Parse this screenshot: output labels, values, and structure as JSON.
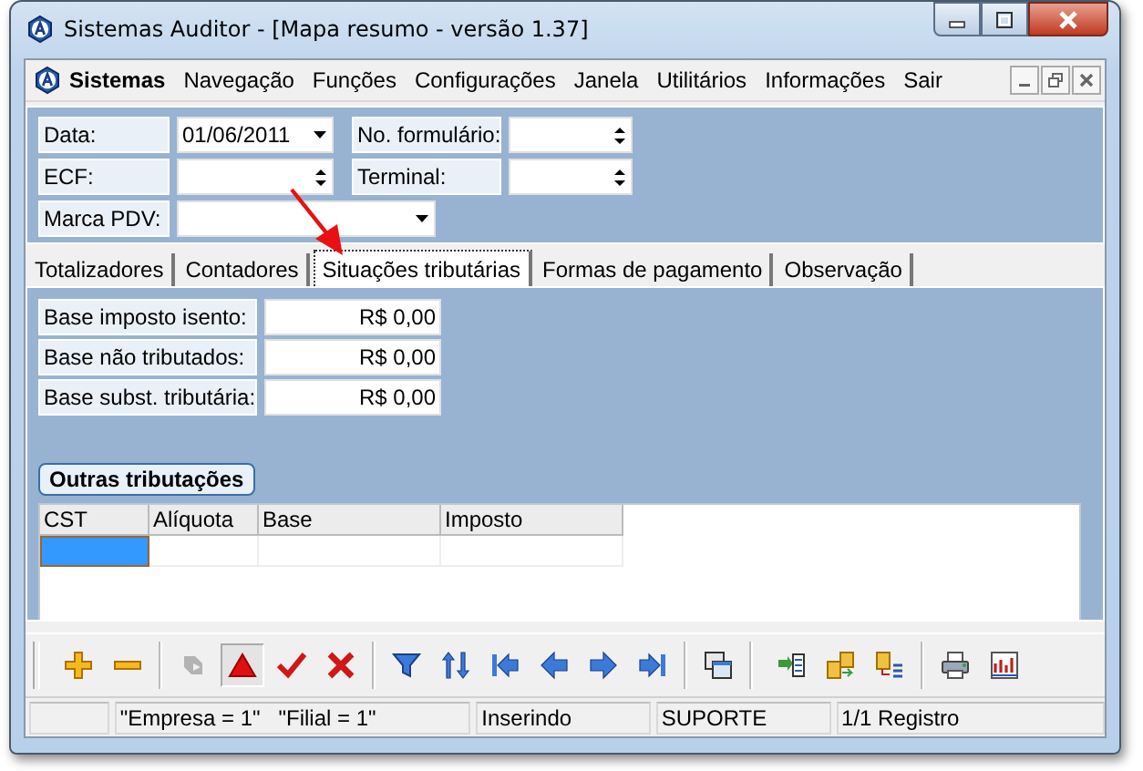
{
  "window": {
    "title": "Sistemas Auditor - [Mapa resumo - versão 1.37]"
  },
  "menu": {
    "app_title": "Sistemas",
    "items": [
      "Navegação",
      "Funções",
      "Configurações",
      "Janela",
      "Utilitários",
      "Informações",
      "Sair"
    ]
  },
  "form": {
    "rows": [
      [
        {
          "label": "Data:",
          "kind": "dropdown",
          "value": "01/06/2011"
        },
        {
          "label": "No. formulário:",
          "kind": "spin"
        }
      ],
      [
        {
          "label": "ECF:",
          "kind": "spin"
        },
        {
          "label": "Terminal:",
          "kind": "spin"
        }
      ],
      [
        {
          "label": "Marca PDV:",
          "kind": "wide-dropdown"
        }
      ]
    ]
  },
  "tabs": [
    {
      "label": "Totalizadores",
      "selected": false
    },
    {
      "label": "Contadores",
      "selected": false
    },
    {
      "label": "Situações tributárias",
      "selected": true
    },
    {
      "label": "Formas de pagamento",
      "selected": false
    },
    {
      "label": "Observação",
      "selected": false
    }
  ],
  "callout_arrow": true,
  "totals": [
    {
      "label": "Base imposto isento:",
      "value": "R$ 0,00"
    },
    {
      "label": "Base não tributados:",
      "value": "R$ 0,00"
    },
    {
      "label": "Base subst. tributária:",
      "value": "R$ 0,00"
    }
  ],
  "other_taxes": {
    "title": "Outras tributações",
    "columns": [
      "CST",
      "Alíquota",
      "Base",
      "Imposto"
    ],
    "rows": [
      {
        "selected": true
      }
    ]
  },
  "toolbar": {
    "groups": [
      [
        {
          "disabled": false,
          "pressed": false
        },
        {
          "disabled": false,
          "pressed": false
        }
      ],
      [
        {
          "disabled": true,
          "pressed": false
        },
        {
          "disabled": false,
          "pressed": true
        },
        {
          "disabled": false,
          "pressed": false
        },
        {
          "disabled": false,
          "pressed": false
        }
      ],
      [
        {
          "disabled": false,
          "pressed": false
        },
        {
          "disabled": false,
          "pressed": false
        },
        {
          "disabled": false,
          "pressed": false
        },
        {
          "disabled": false,
          "pressed": false
        },
        {
          "disabled": false,
          "pressed": false
        },
        {
          "disabled": false,
          "pressed": false
        }
      ],
      [
        {
          "disabled": false,
          "pressed": false
        }
      ],
      [
        {
          "disabled": false,
          "pressed": false
        },
        {
          "disabled": false,
          "pressed": false
        },
        {
          "disabled": false,
          "pressed": false
        }
      ],
      [
        {
          "disabled": false,
          "pressed": false
        },
        {
          "disabled": false,
          "pressed": false
        }
      ]
    ]
  },
  "status_bar": [
    "\"Empresa = 1\"   \"Filial = 1\"",
    "Inserindo",
    "SUPORTE",
    "1/1 Registro"
  ]
}
